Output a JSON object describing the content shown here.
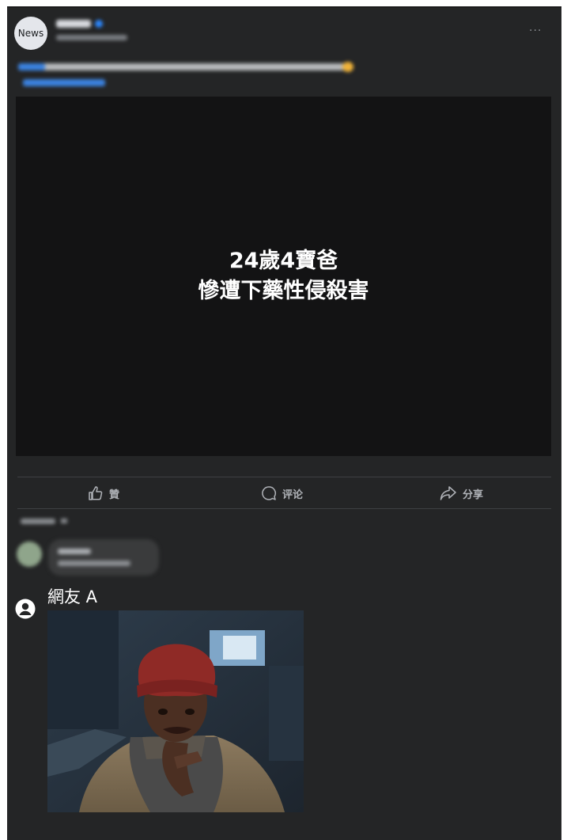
{
  "post": {
    "avatar_text": "News",
    "video_overlay": {
      "line1": "24歲4寶爸",
      "line2": "慘遭下藥性侵殺害"
    }
  },
  "actions": {
    "like_label": "贊",
    "comment_label": "评论",
    "share_label": "分享"
  },
  "annotation": {
    "user_label": "網友 A",
    "meme_image": "man-in-red-beanie-scratching-neck"
  },
  "colors": {
    "card_bg": "#242526",
    "video_bg": "#131314",
    "action_text": "#b0b3b8",
    "link_blue": "#3b82e0"
  }
}
